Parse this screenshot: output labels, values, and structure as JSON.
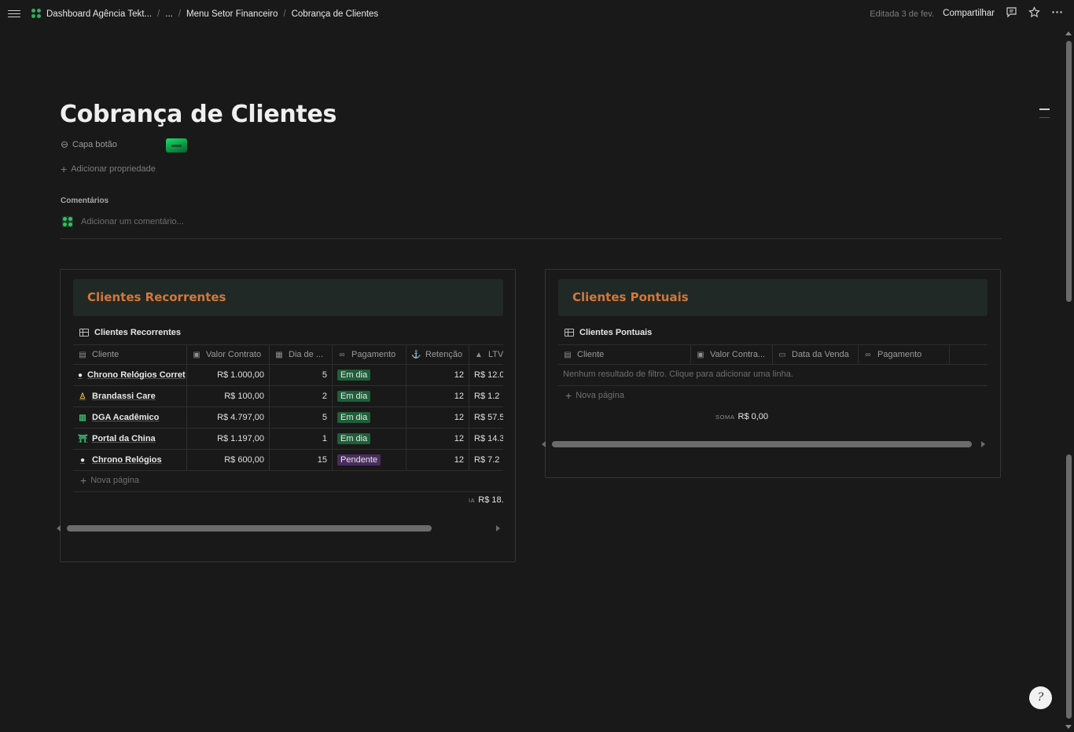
{
  "topbar": {
    "breadcrumbs": [
      "Dashboard Agência Tekt...",
      "...",
      "Menu Setor Financeiro",
      "Cobrança de Clientes"
    ],
    "edited": "Editada 3 de fev.",
    "share": "Compartilhar",
    "icons": [
      "menu-icon",
      "comment-icon",
      "star-icon",
      "more-icon"
    ]
  },
  "page": {
    "title": "Cobrança de Clientes",
    "property_label": "Capa botão",
    "add_property": "Adicionar propriedade",
    "comments_label": "Comentários",
    "comment_placeholder": "Adicionar um comentário...",
    "accent_color": "#d4773a"
  },
  "recorrentes": {
    "callout_title": "Clientes Recorrentes",
    "db_title": "Clientes Recorrentes",
    "headers": [
      "Cliente",
      "Valor Contrato",
      "Dia de ...",
      "Pagamento",
      "Retenção",
      "LTV"
    ],
    "rows": [
      {
        "cliente": "Chrono Relógios Corret",
        "valor": "R$ 1.000,00",
        "dia": "5",
        "pagamento": "Em dia",
        "retencao": "12",
        "ltv": "R$ 12.0",
        "icon": "clock-icon"
      },
      {
        "cliente": "Brandassi Care",
        "valor": "R$ 100,00",
        "dia": "2",
        "pagamento": "Em dia",
        "retencao": "12",
        "ltv": "R$ 1.2",
        "icon": "person-icon"
      },
      {
        "cliente": "DGA Acadêmico",
        "valor": "R$ 4.797,00",
        "dia": "5",
        "pagamento": "Em dia",
        "retencao": "12",
        "ltv": "R$ 57.5",
        "icon": "book-icon"
      },
      {
        "cliente": "Portal da China",
        "valor": "R$ 1.197,00",
        "dia": "1",
        "pagamento": "Em dia",
        "retencao": "12",
        "ltv": "R$ 14.3",
        "icon": "temple-icon"
      },
      {
        "cliente": "Chrono Relógios",
        "valor": "R$ 600,00",
        "dia": "15",
        "pagamento": "Pendente",
        "retencao": "12",
        "ltv": "R$ 7.2",
        "icon": "clock-icon"
      }
    ],
    "new_page": "Nova página",
    "sum_label": "IA",
    "sum_value": "R$ 18.",
    "status_colors": {
      "em_dia": "#1f5f3a",
      "pendente": "#4a2d5e"
    }
  },
  "pontuais": {
    "callout_title": "Clientes Pontuais",
    "db_title": "Clientes Pontuais",
    "headers": [
      "Cliente",
      "Valor Contra...",
      "Data da Venda",
      "Pagamento"
    ],
    "empty_message": "Nenhum resultado de filtro. Clique para adicionar uma linha.",
    "new_page": "Nova página",
    "sum_label": "SOMA",
    "sum_value": "R$ 0,00"
  },
  "help": "?"
}
